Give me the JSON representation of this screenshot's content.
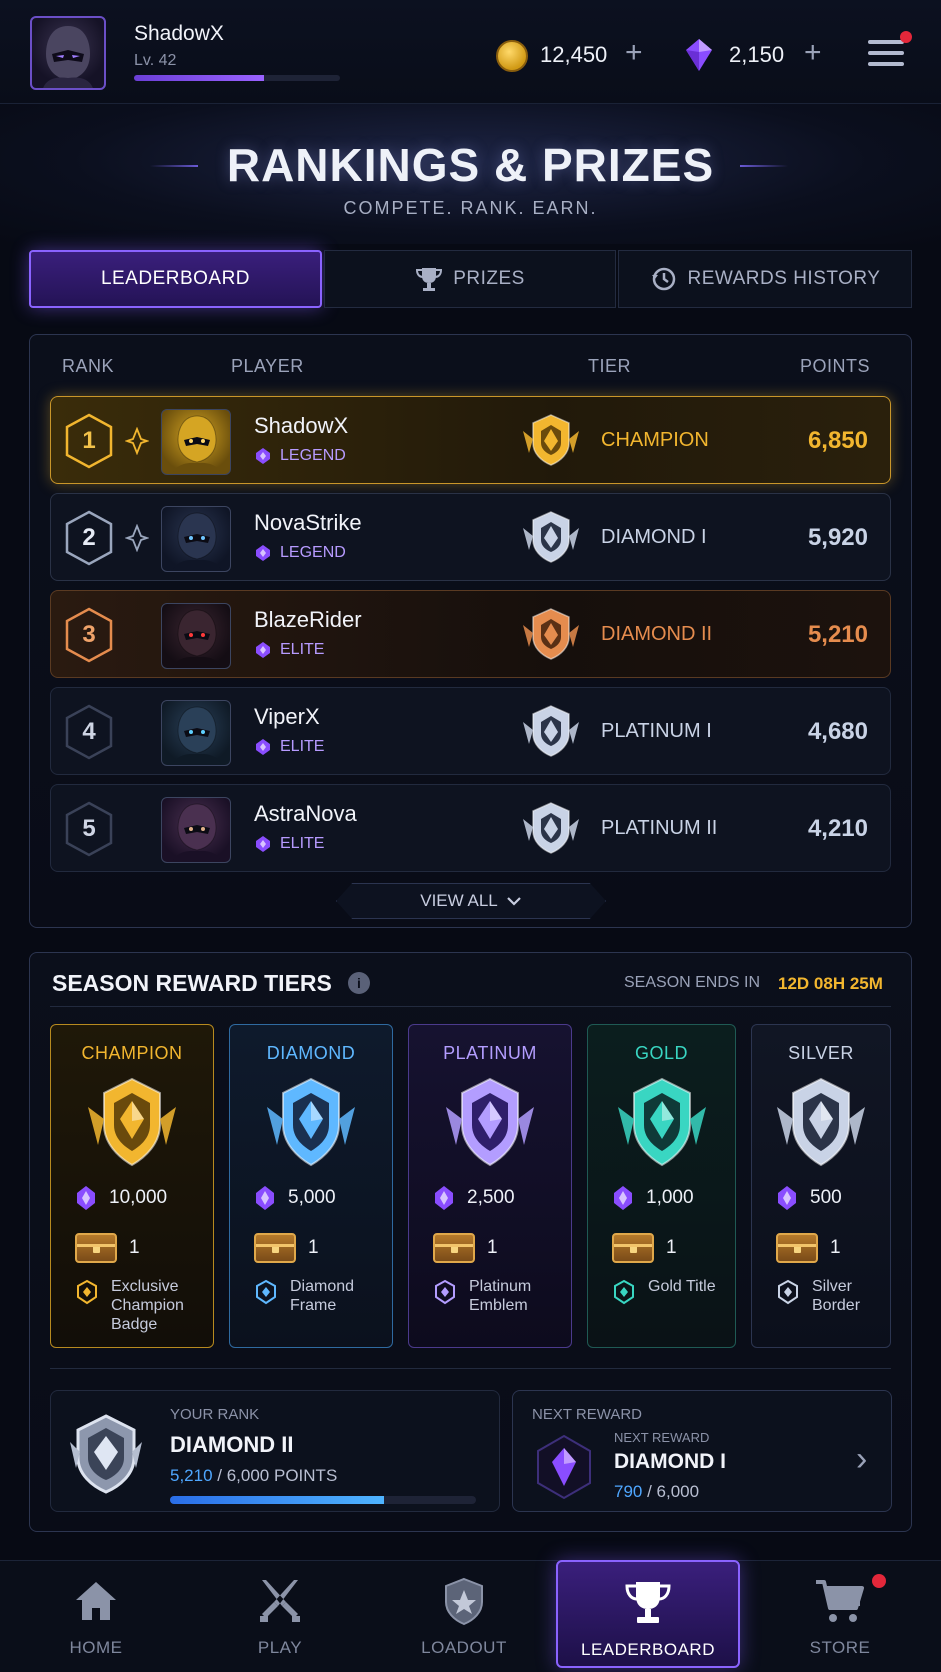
{
  "player": {
    "name": "ShadowX",
    "level": "Lv. 42",
    "xp_progress": 0.63
  },
  "currency": {
    "coins": "12,450",
    "gems": "2,150",
    "plus": "+"
  },
  "hero": {
    "title": "RANKINGS & PRIZES",
    "subtitle": "COMPETE. RANK. EARN."
  },
  "tabs": [
    {
      "label": "LEADERBOARD",
      "active": true
    },
    {
      "label": "PRIZES",
      "icon": "trophy-icon"
    },
    {
      "label": "REWARDS HISTORY",
      "icon": "history-icon"
    }
  ],
  "leaderboard": {
    "headers": {
      "rank": "RANK",
      "player": "PLAYER",
      "tier": "TIER",
      "points": "POINTS"
    },
    "rows": [
      {
        "rank": "1",
        "name": "ShadowX",
        "badge": "LEGEND",
        "tier": "CHAMPION",
        "points": "6,850",
        "accent": "#f2b62f"
      },
      {
        "rank": "2",
        "name": "NovaStrike",
        "badge": "LEGEND",
        "tier": "DIAMOND I",
        "points": "5,920",
        "accent": "#c9d3e6"
      },
      {
        "rank": "3",
        "name": "BlazeRider",
        "badge": "ELITE",
        "tier": "DIAMOND II",
        "points": "5,210",
        "accent": "#e58c4e"
      },
      {
        "rank": "4",
        "name": "ViperX",
        "badge": "ELITE",
        "tier": "PLATINUM I",
        "points": "4,680",
        "accent": "#c9d3e6"
      },
      {
        "rank": "5",
        "name": "AstraNova",
        "badge": "ELITE",
        "tier": "PLATINUM II",
        "points": "4,210",
        "accent": "#c9d3e6"
      }
    ],
    "view_all": "VIEW ALL"
  },
  "season": {
    "title": "SEASON REWARD TIERS",
    "ends_label": "SEASON ENDS IN",
    "timer": "12D 08H 25M",
    "tiers": [
      {
        "name": "CHAMPION",
        "gems": "10,000",
        "chests": "1",
        "extra": "Exclusive Champion Badge",
        "color": "#f2b62f"
      },
      {
        "name": "DIAMOND",
        "gems": "5,000",
        "chests": "1",
        "extra": "Diamond Frame",
        "color": "#5fb8ff"
      },
      {
        "name": "PLATINUM",
        "gems": "2,500",
        "chests": "1",
        "extra": "Platinum Emblem",
        "color": "#b39dff"
      },
      {
        "name": "GOLD",
        "gems": "1,000",
        "chests": "1",
        "extra": "Gold Title",
        "color": "#39d6c2"
      },
      {
        "name": "SILVER",
        "gems": "500",
        "chests": "1",
        "extra": "Silver Border",
        "color": "#c9d3e6"
      }
    ]
  },
  "your_rank": {
    "label": "YOUR RANK",
    "tier": "DIAMOND II",
    "current": "5,210",
    "target": "6,000",
    "unit": "POINTS",
    "progress": 0.7
  },
  "next_reward": {
    "label": "NEXT REWARD",
    "small_label": "NEXT REWARD",
    "tier": "DIAMOND I",
    "current": "790",
    "target": "6,000"
  },
  "nav": [
    {
      "label": "HOME",
      "icon": "home-icon"
    },
    {
      "label": "PLAY",
      "icon": "crossed-swords-icon"
    },
    {
      "label": "LOADOUT",
      "icon": "shield-icon"
    },
    {
      "label": "LEADERBOARD",
      "icon": "trophy-icon",
      "active": true
    },
    {
      "label": "STORE",
      "icon": "cart-icon"
    }
  ]
}
